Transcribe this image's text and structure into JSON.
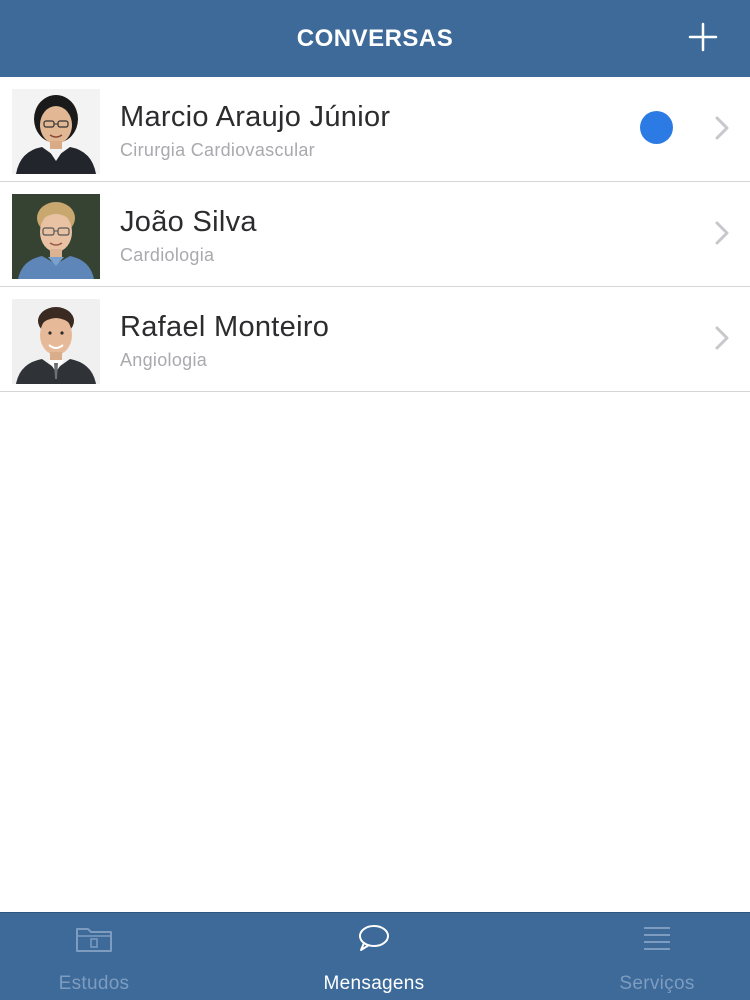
{
  "header": {
    "title": "CONVERSAS",
    "add_icon": "plus-icon"
  },
  "conversations": [
    {
      "name": "Marcio Araujo Júnior",
      "specialty": "Cirurgia Cardiovascular",
      "unread": true,
      "avatar_icon": "avatar-photo"
    },
    {
      "name": "João Silva",
      "specialty": "Cardiologia",
      "unread": false,
      "avatar_icon": "avatar-photo"
    },
    {
      "name": "Rafael Monteiro",
      "specialty": "Angiologia",
      "unread": false,
      "avatar_icon": "avatar-photo"
    }
  ],
  "tabbar": {
    "tabs": [
      {
        "label": "Estudos",
        "icon": "folder-icon",
        "active": false
      },
      {
        "label": "Mensagens",
        "icon": "chat-bubble-icon",
        "active": true
      },
      {
        "label": "Serviços",
        "icon": "list-icon",
        "active": false
      }
    ]
  },
  "colors": {
    "brand": "#3d6a99",
    "unread_dot": "#2c7be5",
    "tab_inactive": "#7d9cc0",
    "tab_active": "#ffffff"
  }
}
